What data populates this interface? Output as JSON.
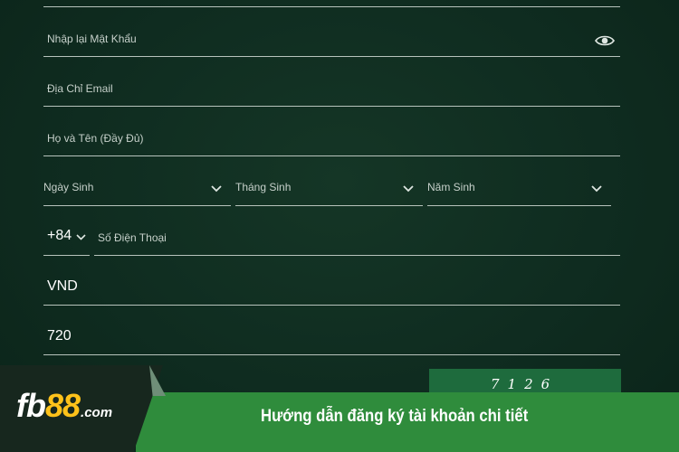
{
  "form": {
    "confirm_password_placeholder": "Nhập lại Mật Khẩu",
    "email_placeholder": "Địa Chỉ Email",
    "fullname_placeholder": "Họ và Tên (Đầy Đủ)",
    "birth_day_label": "Ngày Sinh",
    "birth_month_label": "Tháng Sinh",
    "birth_year_label": "Năm Sinh",
    "phone_prefix": "+84",
    "phone_placeholder": "Số Điện Thoại",
    "currency_value": "VND",
    "captcha_input_value": "720",
    "captcha_code": "7126"
  },
  "banner": {
    "logo_fb": "fb",
    "logo_num": "88",
    "logo_com": ".com",
    "title": "Hướng dẫn đăng ký tài khoản chi tiết"
  },
  "icons": {
    "password_toggle": "eye-icon",
    "select_arrow": "chevron-down-icon"
  },
  "colors": {
    "background": "#0e2a1e",
    "banner_green": "#2f8c3c",
    "logo_accent": "#ffc21a",
    "captcha_bg": "#1e6b3d"
  }
}
